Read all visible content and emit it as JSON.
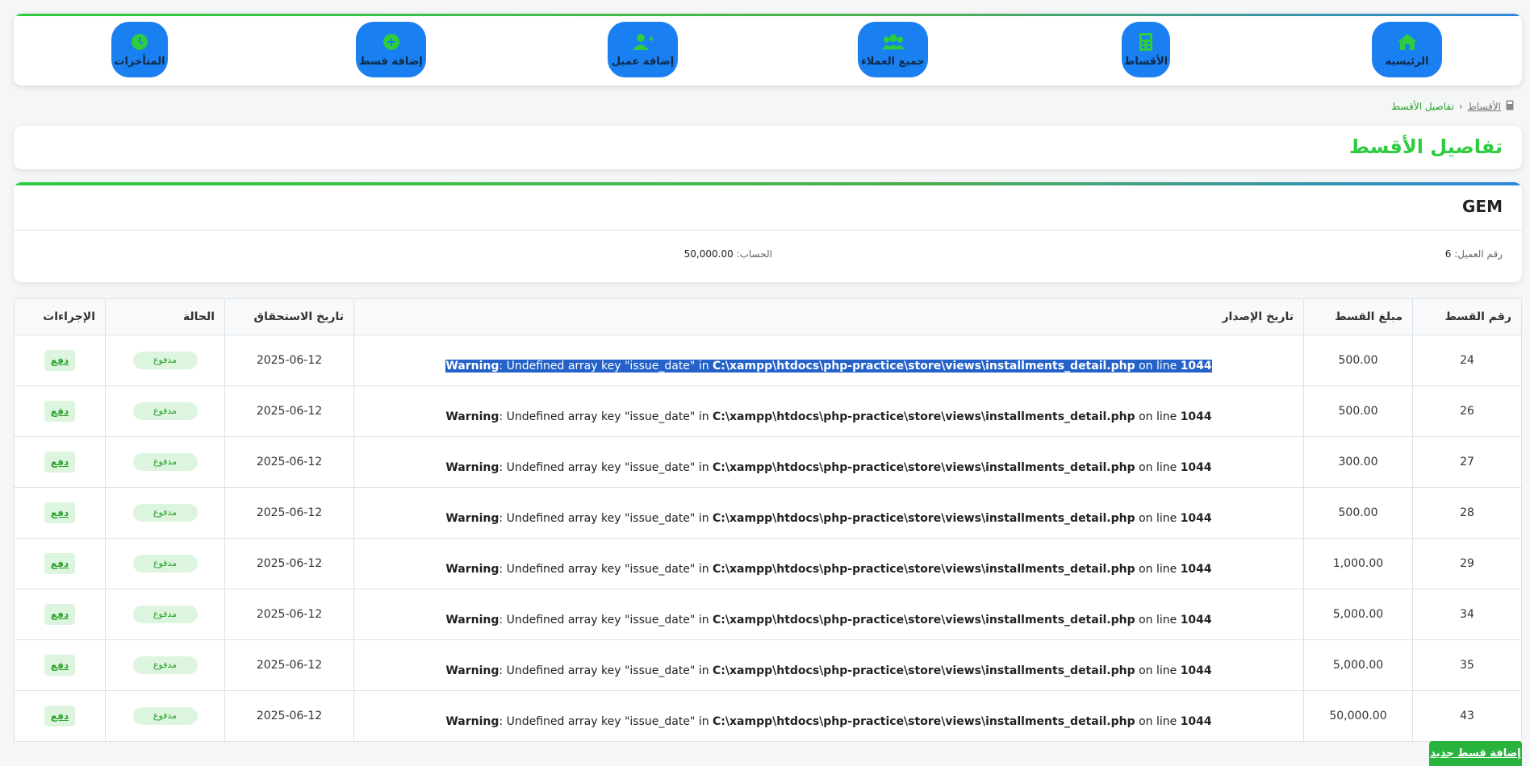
{
  "nav": {
    "items": [
      {
        "label": "الرئيسيه",
        "icon": "home-icon"
      },
      {
        "label": "الأقساط",
        "icon": "calculator-icon"
      },
      {
        "label": "جميع العملاء",
        "icon": "users-icon"
      },
      {
        "label": "إضافة عميل",
        "icon": "user-plus-icon"
      },
      {
        "label": "إضافة قسط",
        "icon": "plus-circle-icon"
      },
      {
        "label": "المتأخرات",
        "icon": "clock-icon"
      }
    ]
  },
  "breadcrumb": {
    "parent": "الأقساط",
    "current": "تفاصيل الأقسط"
  },
  "page": {
    "title": "تفاصيل الأقسط"
  },
  "customer": {
    "name": "GEM",
    "id_label": "رقم العميل:",
    "id_value": "6",
    "account_label": "الحساب:",
    "account_value": "50,000.00"
  },
  "table": {
    "headers": [
      "رقم القسط",
      "مبلغ القسط",
      "تاريخ الإصدار",
      "تاريخ الاستحقاق",
      "الحالة",
      "الإجراءات"
    ],
    "warning": {
      "prefix": "Warning",
      "message": ": Undefined array key \"issue_date\" in ",
      "path": "C:\\xampp\\htdocs\\php-practice\\store\\views\\installments_detail.php",
      "online": " on line ",
      "line": "1044"
    },
    "rows": [
      {
        "id": "24",
        "amount": "500.00",
        "due": "2025-06-12",
        "status": "مدفوع",
        "action": "دفع"
      },
      {
        "id": "26",
        "amount": "500.00",
        "due": "2025-06-12",
        "status": "مدفوع",
        "action": "دفع"
      },
      {
        "id": "27",
        "amount": "300.00",
        "due": "2025-06-12",
        "status": "مدفوع",
        "action": "دفع"
      },
      {
        "id": "28",
        "amount": "500.00",
        "due": "2025-06-12",
        "status": "مدفوع",
        "action": "دفع"
      },
      {
        "id": "29",
        "amount": "1,000.00",
        "due": "2025-06-12",
        "status": "مدفوع",
        "action": "دفع"
      },
      {
        "id": "34",
        "amount": "5,000.00",
        "due": "2025-06-12",
        "status": "مدفوع",
        "action": "دفع"
      },
      {
        "id": "35",
        "amount": "5,000.00",
        "due": "2025-06-12",
        "status": "مدفوع",
        "action": "دفع"
      },
      {
        "id": "43",
        "amount": "50,000.00",
        "due": "2025-06-12",
        "status": "مدفوع",
        "action": "دفع"
      }
    ]
  },
  "add_button": "إضافة قسط جديد",
  "colors": {
    "accent": "#2ecc40",
    "nav_button": "#1a7ff0",
    "selection": "#2462c9"
  }
}
